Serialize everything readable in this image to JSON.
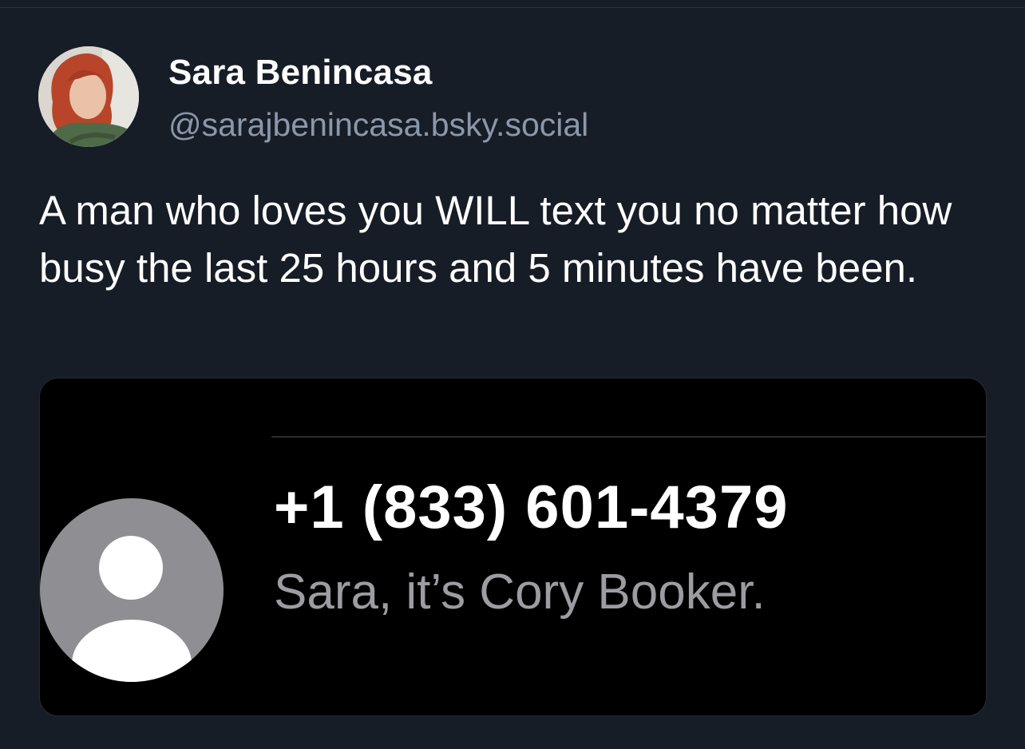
{
  "post": {
    "author": {
      "display_name": "Sara Benincasa",
      "handle": "@sarajbenincasa.bsky.social"
    },
    "text": "A man who loves you WILL text you no matter how busy the last 25 hours and 5 minutes have been."
  },
  "embed": {
    "contact_icon": "person-placeholder-icon",
    "phone_number": "+1 (833) 601-4379",
    "message_preview": "Sara, it’s Cory Booker."
  },
  "colors": {
    "background": "#171d27",
    "handle": "#8b98a9",
    "embed_background": "#000000",
    "preview_text": "#9c9ca1",
    "contact_avatar": "#8e8e93"
  }
}
